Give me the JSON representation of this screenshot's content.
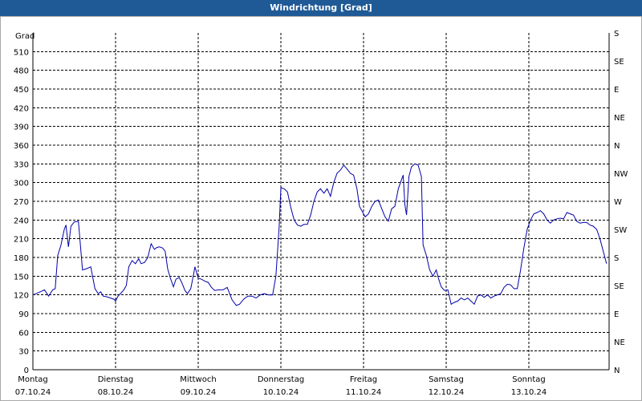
{
  "chart_data": {
    "type": "line",
    "title": "Windrichtung [Grad]",
    "ylabel": "Grad",
    "ylim": [
      0,
      540
    ],
    "yticks": [
      0,
      30,
      60,
      90,
      120,
      150,
      180,
      210,
      240,
      270,
      300,
      330,
      360,
      390,
      420,
      450,
      480,
      510
    ],
    "right_axis": [
      {
        "value": 0,
        "label": "N"
      },
      {
        "value": 45,
        "label": "NE"
      },
      {
        "value": 90,
        "label": "E"
      },
      {
        "value": 135,
        "label": "SE"
      },
      {
        "value": 180,
        "label": "S"
      },
      {
        "value": 225,
        "label": "SW"
      },
      {
        "value": 270,
        "label": "W"
      },
      {
        "value": 315,
        "label": "NW"
      },
      {
        "value": 360,
        "label": "N"
      },
      {
        "value": 405,
        "label": "NE"
      },
      {
        "value": 450,
        "label": "E"
      },
      {
        "value": 495,
        "label": "SE"
      },
      {
        "value": 540,
        "label": "S"
      }
    ],
    "xlim": [
      0,
      7
    ],
    "xticks": [
      {
        "value": 0,
        "day": "Montag",
        "date": "07.10.24"
      },
      {
        "value": 1,
        "day": "Dienstag",
        "date": "08.10.24"
      },
      {
        "value": 2,
        "day": "Mittwoch",
        "date": "09.10.24"
      },
      {
        "value": 3,
        "day": "Donnerstag",
        "date": "10.10.24"
      },
      {
        "value": 4,
        "day": "Freitag",
        "date": "11.10.24"
      },
      {
        "value": 5,
        "day": "Samstag",
        "date": "12.10.24"
      },
      {
        "value": 6,
        "day": "Sonntag",
        "date": "13.10.24"
      }
    ],
    "grid": true,
    "series": [
      {
        "color": "#0000aa",
        "points": [
          [
            0.0,
            120
          ],
          [
            0.04,
            122
          ],
          [
            0.09,
            125
          ],
          [
            0.14,
            128
          ],
          [
            0.19,
            118
          ],
          [
            0.24,
            128
          ],
          [
            0.27,
            130
          ],
          [
            0.3,
            183
          ],
          [
            0.34,
            200
          ],
          [
            0.38,
            225
          ],
          [
            0.4,
            232
          ],
          [
            0.43,
            197
          ],
          [
            0.46,
            230
          ],
          [
            0.5,
            237
          ],
          [
            0.55,
            238
          ],
          [
            0.6,
            160
          ],
          [
            0.65,
            162
          ],
          [
            0.7,
            165
          ],
          [
            0.75,
            130
          ],
          [
            0.79,
            122
          ],
          [
            0.82,
            125
          ],
          [
            0.85,
            118
          ],
          [
            0.89,
            117
          ],
          [
            0.94,
            115
          ],
          [
            0.98,
            113
          ],
          [
            1.0,
            110
          ],
          [
            1.03,
            118
          ],
          [
            1.06,
            122
          ],
          [
            1.1,
            128
          ],
          [
            1.13,
            135
          ],
          [
            1.16,
            165
          ],
          [
            1.2,
            175
          ],
          [
            1.24,
            170
          ],
          [
            1.28,
            178
          ],
          [
            1.31,
            170
          ],
          [
            1.35,
            172
          ],
          [
            1.39,
            180
          ],
          [
            1.43,
            202
          ],
          [
            1.47,
            193
          ],
          [
            1.5,
            196
          ],
          [
            1.53,
            197
          ],
          [
            1.57,
            195
          ],
          [
            1.6,
            190
          ],
          [
            1.63,
            162
          ],
          [
            1.66,
            148
          ],
          [
            1.7,
            133
          ],
          [
            1.73,
            145
          ],
          [
            1.77,
            148
          ],
          [
            1.8,
            140
          ],
          [
            1.84,
            127
          ],
          [
            1.87,
            122
          ],
          [
            1.91,
            130
          ],
          [
            1.94,
            150
          ],
          [
            1.96,
            165
          ],
          [
            2.0,
            147
          ],
          [
            2.04,
            145
          ],
          [
            2.08,
            142
          ],
          [
            2.12,
            140
          ],
          [
            2.16,
            132
          ],
          [
            2.2,
            127
          ],
          [
            2.24,
            128
          ],
          [
            2.3,
            128
          ],
          [
            2.35,
            132
          ],
          [
            2.41,
            112
          ],
          [
            2.46,
            103
          ],
          [
            2.5,
            105
          ],
          [
            2.55,
            113
          ],
          [
            2.6,
            118
          ],
          [
            2.65,
            118
          ],
          [
            2.7,
            115
          ],
          [
            2.75,
            120
          ],
          [
            2.8,
            122
          ],
          [
            2.85,
            120
          ],
          [
            2.9,
            120
          ],
          [
            2.94,
            150
          ],
          [
            2.98,
            230
          ],
          [
            3.0,
            292
          ],
          [
            3.04,
            290
          ],
          [
            3.08,
            285
          ],
          [
            3.12,
            260
          ],
          [
            3.16,
            240
          ],
          [
            3.2,
            232
          ],
          [
            3.24,
            230
          ],
          [
            3.28,
            233
          ],
          [
            3.32,
            233
          ],
          [
            3.36,
            248
          ],
          [
            3.4,
            270
          ],
          [
            3.44,
            285
          ],
          [
            3.48,
            290
          ],
          [
            3.52,
            283
          ],
          [
            3.56,
            290
          ],
          [
            3.6,
            278
          ],
          [
            3.64,
            300
          ],
          [
            3.68,
            315
          ],
          [
            3.72,
            320
          ],
          [
            3.76,
            328
          ],
          [
            3.8,
            322
          ],
          [
            3.84,
            315
          ],
          [
            3.88,
            312
          ],
          [
            3.92,
            290
          ],
          [
            3.95,
            262
          ],
          [
            3.98,
            255
          ],
          [
            4.02,
            245
          ],
          [
            4.06,
            250
          ],
          [
            4.1,
            262
          ],
          [
            4.14,
            270
          ],
          [
            4.18,
            272
          ],
          [
            4.22,
            258
          ],
          [
            4.26,
            245
          ],
          [
            4.3,
            238
          ],
          [
            4.34,
            258
          ],
          [
            4.38,
            262
          ],
          [
            4.42,
            290
          ],
          [
            4.46,
            305
          ],
          [
            4.48,
            312
          ],
          [
            4.5,
            265
          ],
          [
            4.52,
            248
          ],
          [
            4.55,
            310
          ],
          [
            4.58,
            325
          ],
          [
            4.62,
            330
          ],
          [
            4.66,
            328
          ],
          [
            4.7,
            310
          ],
          [
            4.72,
            200
          ],
          [
            4.76,
            183
          ],
          [
            4.8,
            160
          ],
          [
            4.84,
            150
          ],
          [
            4.88,
            160
          ],
          [
            4.91,
            145
          ],
          [
            4.94,
            133
          ],
          [
            4.98,
            127
          ],
          [
            5.02,
            128
          ],
          [
            5.06,
            105
          ],
          [
            5.1,
            108
          ],
          [
            5.14,
            110
          ],
          [
            5.18,
            115
          ],
          [
            5.22,
            112
          ],
          [
            5.26,
            115
          ],
          [
            5.3,
            110
          ],
          [
            5.34,
            105
          ],
          [
            5.38,
            118
          ],
          [
            5.42,
            120
          ],
          [
            5.46,
            116
          ],
          [
            5.5,
            120
          ],
          [
            5.54,
            115
          ],
          [
            5.58,
            118
          ],
          [
            5.62,
            120
          ],
          [
            5.66,
            122
          ],
          [
            5.7,
            132
          ],
          [
            5.74,
            137
          ],
          [
            5.78,
            136
          ],
          [
            5.82,
            130
          ],
          [
            5.86,
            130
          ],
          [
            5.9,
            160
          ],
          [
            5.94,
            195
          ],
          [
            5.98,
            225
          ],
          [
            6.02,
            240
          ],
          [
            6.06,
            250
          ],
          [
            6.1,
            252
          ],
          [
            6.14,
            255
          ],
          [
            6.18,
            250
          ],
          [
            6.22,
            240
          ],
          [
            6.26,
            235
          ],
          [
            6.3,
            240
          ],
          [
            6.34,
            242
          ],
          [
            6.38,
            243
          ],
          [
            6.42,
            242
          ],
          [
            6.46,
            252
          ],
          [
            6.5,
            250
          ],
          [
            6.54,
            248
          ],
          [
            6.58,
            238
          ],
          [
            6.62,
            235
          ],
          [
            6.66,
            236
          ],
          [
            6.7,
            236
          ],
          [
            6.74,
            232
          ],
          [
            6.78,
            230
          ],
          [
            6.82,
            225
          ],
          [
            6.86,
            210
          ],
          [
            6.9,
            190
          ],
          [
            6.94,
            170
          ]
        ]
      }
    ]
  }
}
